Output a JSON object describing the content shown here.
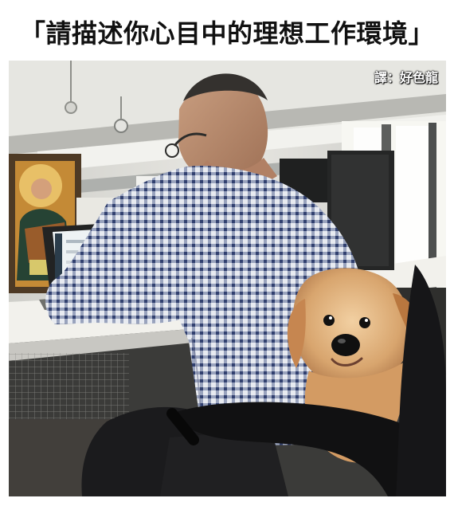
{
  "meme": {
    "title": "「請描述你心目中的理想工作環境」",
    "credit": "譯：好色龍"
  },
  "photo": {
    "subject": "office-worker-with-golden-retriever-puppy"
  },
  "colors": {
    "page_background": "#ffffff",
    "title_text": "#111111",
    "credit_text": "#ffffff",
    "shirt_check": "#31406f",
    "puppy_fur": "#d8a56e"
  }
}
